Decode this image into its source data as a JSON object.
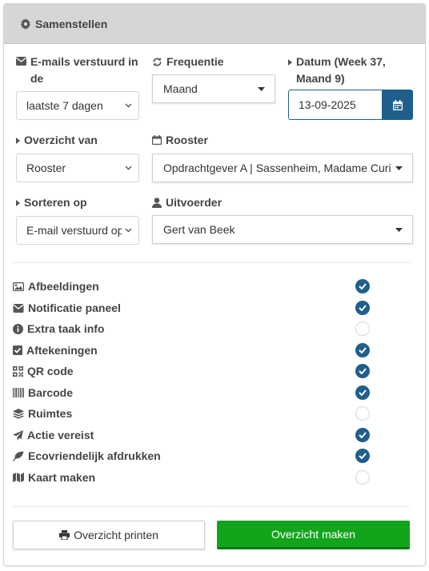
{
  "panel": {
    "title": "Samenstellen",
    "title_icon": "gear-icon"
  },
  "emails": {
    "label": "E-mails verstuurd in de",
    "icon": "envelope-icon",
    "value": "laatste 7 dagen"
  },
  "frequentie": {
    "label": "Frequentie",
    "icon": "refresh-icon",
    "value": "Maand"
  },
  "datum": {
    "label": "Datum (Week 37, Maand 9)",
    "value": "13-09-2025",
    "button_icon": "calendar-icon"
  },
  "overzicht_van": {
    "label": "Overzicht van",
    "value": "Rooster"
  },
  "rooster": {
    "label": "Rooster",
    "icon": "calendar-icon",
    "value": "Opdrachtgever A | Sassenheim, Madame Curie"
  },
  "sorteren_op": {
    "label": "Sorteren op",
    "value": "E-mail verstuurd op"
  },
  "uitvoerder": {
    "label": "Uitvoerder",
    "icon": "user-icon",
    "value": "Gert van Beek"
  },
  "options": [
    {
      "label": "Afbeeldingen",
      "icon": "image-icon",
      "checked": true
    },
    {
      "label": "Notificatie paneel",
      "icon": "envelope-icon",
      "checked": true
    },
    {
      "label": "Extra taak info",
      "icon": "info-circle-icon",
      "checked": false
    },
    {
      "label": "Aftekeningen",
      "icon": "checkbox-icon",
      "checked": true
    },
    {
      "label": "QR code",
      "icon": "qrcode-icon",
      "checked": true
    },
    {
      "label": "Barcode",
      "icon": "barcode-icon",
      "checked": true
    },
    {
      "label": "Ruimtes",
      "icon": "layers-icon",
      "checked": false
    },
    {
      "label": "Actie vereist",
      "icon": "paper-plane-icon",
      "checked": true
    },
    {
      "label": "Ecovriendelijk afdrukken",
      "icon": "leaf-icon",
      "checked": true
    },
    {
      "label": "Kaart maken",
      "icon": "map-icon",
      "checked": false
    }
  ],
  "buttons": {
    "print_label": "Overzicht printen",
    "make_label": "Overzicht maken"
  },
  "colors": {
    "accent": "#1f5f8b",
    "primary_action": "#12a51c",
    "header_bg": "#d6d6d6"
  }
}
